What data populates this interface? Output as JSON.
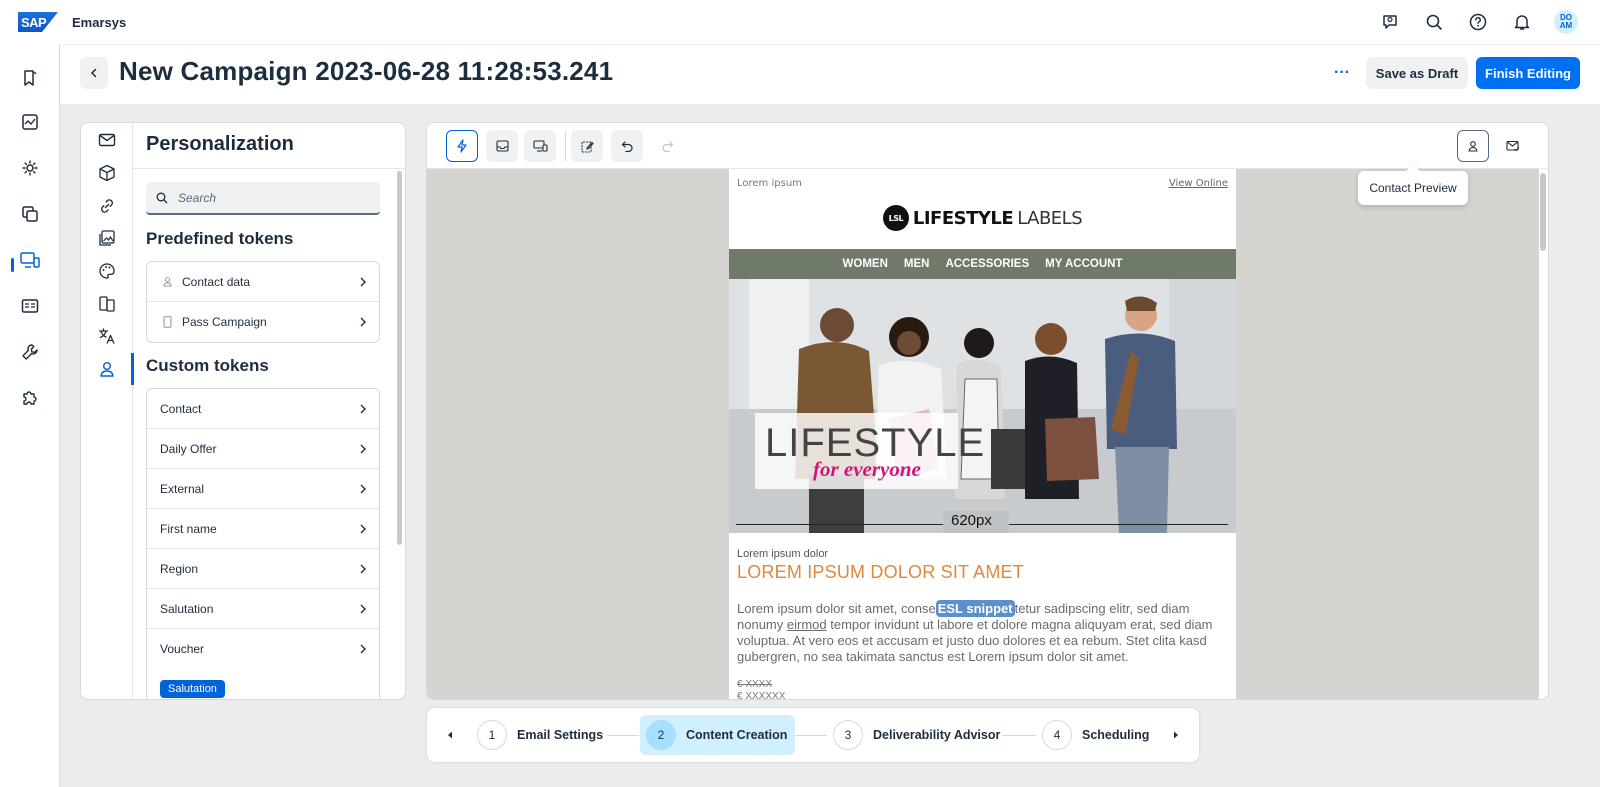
{
  "shell": {
    "logo": "SAP",
    "app_name": "Emarsys",
    "avatar_initials": "DO AM",
    "icons": [
      "chat-bot-icon",
      "search-icon",
      "help-icon",
      "notification-bell-icon"
    ]
  },
  "leftnav": {
    "items": [
      "campaign-icon",
      "analytics-icon",
      "automation-icon",
      "content-icon",
      "channels-icon",
      "contacts-icon",
      "tools-icon",
      "addons-icon"
    ],
    "active_index": 4
  },
  "header": {
    "title": "New Campaign 2023-06-28 11:28:53.241",
    "more_label": "···",
    "save_draft_label": "Save as Draft",
    "finish_label": "Finish Editing"
  },
  "panel": {
    "title": "Personalization",
    "search_placeholder": "Search",
    "predefined_heading": "Predefined tokens",
    "predefined": [
      {
        "label": "Contact data",
        "icon": "person-icon"
      },
      {
        "label": "Pass Campaign",
        "icon": "phone-icon"
      }
    ],
    "custom_heading": "Custom tokens",
    "custom": [
      "Contact",
      "Daily Offer",
      "External",
      "First name",
      "Region",
      "Salutation",
      "Voucher"
    ],
    "token_badge": "Salutation",
    "rail_icons": [
      "mail-icon",
      "cube-icon",
      "link-icon",
      "image-icon",
      "palette-icon",
      "pages-icon",
      "translate-icon",
      "person-icon"
    ]
  },
  "editor": {
    "tooltip": "Contact Preview",
    "toolbar_icons": [
      "lightning-icon",
      "inbox-icon",
      "devices-icon",
      "edit-icon",
      "undo-icon",
      "redo-icon",
      "contact-preview-icon",
      "mail-check-icon"
    ]
  },
  "email": {
    "top_line": "Lorem ipsum",
    "view_online": "View Online",
    "brand_logo": "LSL",
    "brand_bold": "LIFESTYLE",
    "brand_light": "LABELS",
    "nav": [
      "WOMEN",
      "MEN",
      "ACCESSORIES",
      "MY ACCOUNT"
    ],
    "hero_line1": "LIFESTYLE",
    "hero_line2": "for everyone",
    "width_label": "620px",
    "pre_heading": "Lorem ipsum dolor",
    "heading": "LOREM IPSUM DOLOR SIT AMET",
    "text_a": "Lorem ipsum dolor sit amet, conse",
    "snippet": "ESL snippet",
    "text_b": "tetur sadipscing elitr, sed diam nonumy ",
    "text_link": "eirmod",
    "text_c": " tempor invidunt ut labore et dolore magna aliquyam erat, sed diam voluptua. At vero eos et accusam et justo duo dolores et ea rebum. Stet clita kasd gubergren, no sea takimata sanctus est Lorem ipsum dolor sit amet.",
    "price_old": "€ XXXX",
    "price_new": "€ XXXXXX"
  },
  "stepper": {
    "steps": [
      {
        "num": "1",
        "label": "Email Settings"
      },
      {
        "num": "2",
        "label": "Content Creation"
      },
      {
        "num": "3",
        "label": "Deliverability Advisor"
      },
      {
        "num": "4",
        "label": "Scheduling"
      }
    ],
    "active_step": 2
  },
  "colors": {
    "accent": "#0070f2",
    "email_nav": "#6f7a6b",
    "email_heading": "#e0873e",
    "hero_tagline": "#d1157a"
  }
}
